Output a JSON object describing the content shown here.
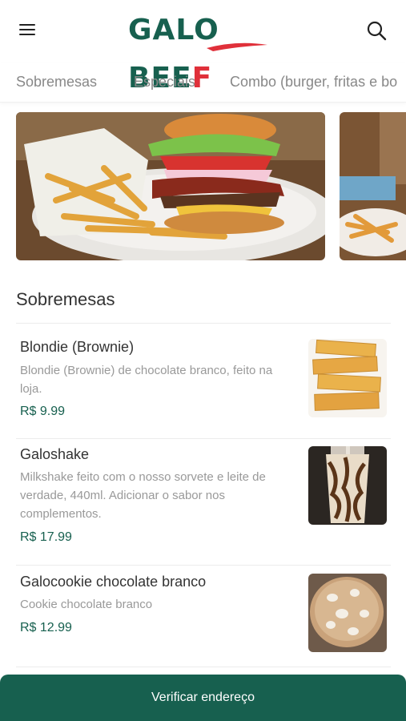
{
  "header": {
    "logo_galo": "GALO",
    "logo_beef": "BEE",
    "logo_f": "F",
    "brand_color": "#17604f",
    "accent_color": "#e0303a"
  },
  "tabs": [
    {
      "label": "Sobremesas"
    },
    {
      "label": "Especiais"
    },
    {
      "label": "Combo (burger, fritas e bo"
    }
  ],
  "section": {
    "title": "Sobremesas"
  },
  "items": [
    {
      "name": "Blondie (Brownie)",
      "description": "Blondie (Brownie) de chocolate branco, feito na loja.",
      "price": "R$ 9.99",
      "image": "blondie-image"
    },
    {
      "name": "Galoshake",
      "description": "Milkshake feito com o nosso sorvete e leite de verdade, 440ml. Adicionar o sabor nos complementos.",
      "price": "R$ 17.99",
      "image": "milkshake-image"
    },
    {
      "name": "Galocookie chocolate branco",
      "description": "Cookie chocolate branco",
      "price": "R$ 12.99",
      "image": "cookie-image"
    }
  ],
  "cta": {
    "label": "Verificar endereço"
  }
}
